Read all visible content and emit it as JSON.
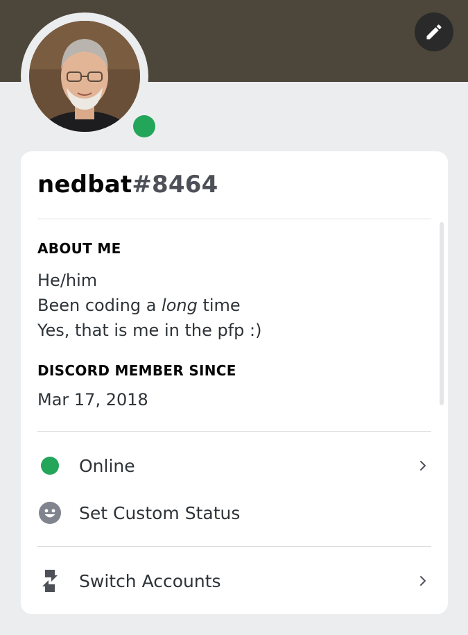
{
  "profile": {
    "username": "nedbat",
    "discriminator": "#8464",
    "status_color": "#23a55a",
    "banner_color": "#4d463a"
  },
  "about": {
    "title": "ABOUT ME",
    "line1": "He/him",
    "line2_prefix": "Been coding a ",
    "line2_emphasis": "long",
    "line2_suffix": " time",
    "line3": "Yes, that is me in the pfp :)"
  },
  "member": {
    "title": "DISCORD MEMBER SINCE",
    "date": "Mar 17, 2018"
  },
  "menu": {
    "online_label": "Online",
    "custom_status_label": "Set Custom Status",
    "switch_accounts_label": "Switch Accounts"
  },
  "icons": {
    "edit": "pencil-icon",
    "online": "online-status-icon",
    "custom_status": "smiley-icon",
    "switch": "switch-accounts-icon",
    "chevron": "chevron-right-icon"
  }
}
